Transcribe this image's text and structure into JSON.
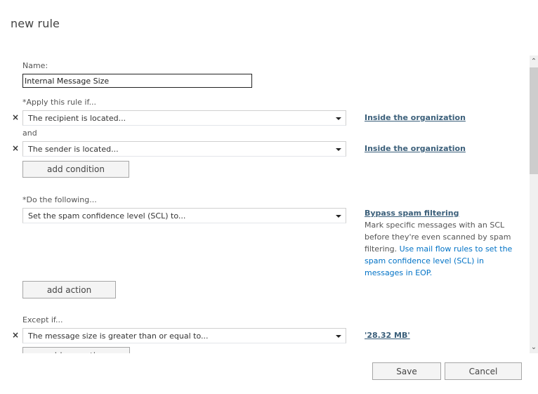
{
  "title": "new rule",
  "form": {
    "name_label": "Name:",
    "name_value": "Internal Message Size",
    "apply_label": "*Apply this rule if...",
    "conditions": [
      {
        "selected": "The recipient is located...",
        "value": "Inside the organization"
      },
      {
        "selected": "The sender is located...",
        "value": "Inside the organization"
      }
    ],
    "and_label": "and",
    "add_condition_label": "add condition",
    "do_label": "*Do the following...",
    "action": {
      "selected": "Set the spam confidence level (SCL) to...",
      "value": "Bypass spam filtering",
      "description_text": "Mark specific messages with an SCL before they're even scanned by spam filtering. ",
      "description_link": "Use mail flow rules to set the spam confidence level (SCL) in messages in EOP."
    },
    "add_action_label": "add action",
    "except_label": "Except if...",
    "exceptions": [
      {
        "selected": "The message size is greater than or equal to...",
        "value": "'28.32 MB'"
      }
    ],
    "add_exception_label": "add exception"
  },
  "footer": {
    "save_label": "Save",
    "cancel_label": "Cancel"
  },
  "icons": {
    "remove": "×",
    "scroll_up": "⌃",
    "scroll_down": "⌄"
  },
  "colors": {
    "link_value": "#3b5f7a",
    "help_link": "#0072c6",
    "scroll_thumb": "#cdcdcd"
  }
}
